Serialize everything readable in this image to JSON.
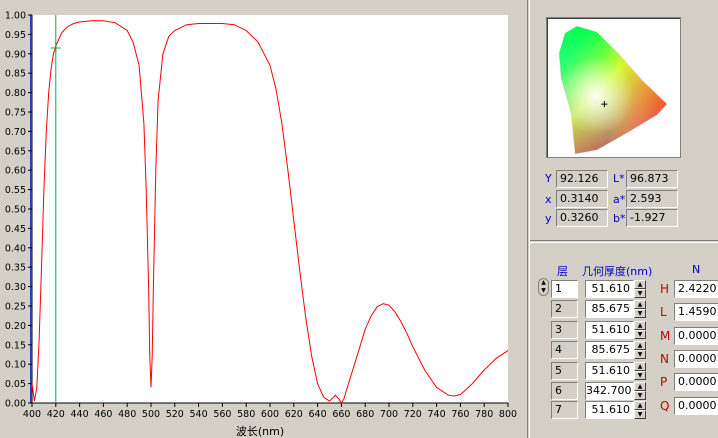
{
  "chart_data": {
    "type": "line",
    "xlabel": "波长(nm)",
    "xlim": [
      400,
      800
    ],
    "ylim": [
      0.0,
      1.0
    ],
    "xticks": [
      400,
      420,
      440,
      460,
      480,
      500,
      520,
      540,
      560,
      580,
      600,
      620,
      640,
      660,
      680,
      700,
      720,
      740,
      760,
      780,
      800
    ],
    "yticks": [
      "0.00",
      "0.05",
      "0.10",
      "0.15",
      "0.20",
      "0.25",
      "0.30",
      "0.35",
      "0.40",
      "0.45",
      "0.50",
      "0.55",
      "0.60",
      "0.65",
      "0.70",
      "0.75",
      "0.80",
      "0.85",
      "0.90",
      "0.95",
      "1.00"
    ],
    "cursor_x": 420,
    "cursor_y": 0.915,
    "series": [
      {
        "color": "#ff0000",
        "x": [
          400,
          402,
          404,
          406,
          408,
          410,
          412,
          414,
          416,
          418,
          420,
          425,
          430,
          435,
          440,
          450,
          460,
          470,
          480,
          485,
          490,
          494,
          496,
          498,
          499,
          500,
          501,
          502,
          504,
          506,
          510,
          515,
          520,
          530,
          540,
          550,
          560,
          570,
          580,
          590,
          600,
          605,
          610,
          615,
          620,
          625,
          630,
          635,
          640,
          645,
          650,
          655,
          658,
          660,
          662,
          665,
          670,
          675,
          680,
          685,
          690,
          695,
          700,
          705,
          710,
          715,
          720,
          730,
          740,
          750,
          755,
          760,
          765,
          770,
          780,
          790,
          800
        ],
        "y": [
          0.05,
          0.005,
          0.04,
          0.16,
          0.35,
          0.55,
          0.7,
          0.8,
          0.86,
          0.9,
          0.92,
          0.955,
          0.97,
          0.978,
          0.982,
          0.985,
          0.985,
          0.98,
          0.96,
          0.93,
          0.87,
          0.72,
          0.55,
          0.3,
          0.12,
          0.04,
          0.12,
          0.3,
          0.6,
          0.78,
          0.9,
          0.945,
          0.96,
          0.975,
          0.978,
          0.978,
          0.978,
          0.975,
          0.96,
          0.93,
          0.87,
          0.81,
          0.72,
          0.6,
          0.47,
          0.34,
          0.22,
          0.12,
          0.05,
          0.015,
          0.005,
          0.02,
          0.01,
          0.0,
          0.01,
          0.04,
          0.09,
          0.14,
          0.19,
          0.225,
          0.248,
          0.256,
          0.252,
          0.235,
          0.21,
          0.18,
          0.145,
          0.085,
          0.04,
          0.02,
          0.018,
          0.022,
          0.035,
          0.05,
          0.085,
          0.115,
          0.135
        ]
      }
    ]
  },
  "color_values": {
    "Y_label": "Y",
    "Y": "92.126",
    "x_label": "x",
    "x": "0.3140",
    "y_label": "y",
    "y": "0.3260",
    "L_label": "L*",
    "L": "96.873",
    "a_label": "a*",
    "a": "2.593",
    "b_label": "b*",
    "b": "-1.927"
  },
  "cie_point": [
    0.314,
    0.326
  ],
  "layers": {
    "layer_header": "层",
    "thickness_header": "几何厚度(nm)",
    "n_header": "N",
    "rows": [
      {
        "layer": "1",
        "thickness": "51.610"
      },
      {
        "layer": "2",
        "thickness": "85.675"
      },
      {
        "layer": "3",
        "thickness": "51.610"
      },
      {
        "layer": "4",
        "thickness": "85.675"
      },
      {
        "layer": "5",
        "thickness": "51.610"
      },
      {
        "layer": "6",
        "thickness": "342.700"
      },
      {
        "layer": "7",
        "thickness": "51.610"
      }
    ]
  },
  "materials": [
    {
      "label": "H",
      "value": "2.4220"
    },
    {
      "label": "L",
      "value": "1.4590"
    },
    {
      "label": "M",
      "value": "0.0000"
    },
    {
      "label": "N",
      "value": "0.0000"
    },
    {
      "label": "P",
      "value": "0.0000"
    },
    {
      "label": "Q",
      "value": "0.0000"
    }
  ]
}
